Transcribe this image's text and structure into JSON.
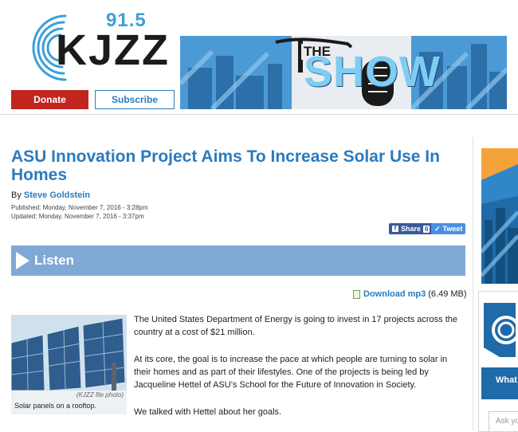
{
  "header": {
    "logo_frequency": "91.5",
    "logo_callsign": "KJZZ",
    "donate_label": "Donate",
    "subscribe_label": "Subscribe",
    "banner_the": "THE",
    "banner_show": "SHOW"
  },
  "article": {
    "title": "ASU Innovation Project Aims To Increase Solar Use In Homes",
    "byline_prefix": "By",
    "author": "Steve Goldstein",
    "published": "Published: Monday, November 7, 2016 - 3:28pm",
    "updated": "Updated: Monday, November 7, 2016 - 3:37pm",
    "share_label": "Share",
    "share_count": "6",
    "tweet_label": "Tweet",
    "listen_label": "Listen",
    "download_label": "Download mp3",
    "download_size": "(6.49 MB)",
    "photo_credit": "(KJZZ file photo)",
    "photo_caption": "Solar panels on a rooftop.",
    "paragraphs": [
      "The United States Department of Energy is going to invest in 17 projects across the country at a cost of $21 million.",
      "At its core, the goal is to increase the pace at which people are turning to solar in their homes and as part of their lifestyles. One of the projects is being led by Jacqueline Hettel of ASU’s School for the Future of Innovation in Society.",
      "We talked with Hettel about her goals."
    ]
  },
  "sidebar": {
    "what_label": "What",
    "ask_placeholder": "Ask yo"
  },
  "colors": {
    "brand_blue": "#2a7bbf",
    "donate_red": "#c2241e",
    "listen_bar": "#7fa8d6"
  }
}
